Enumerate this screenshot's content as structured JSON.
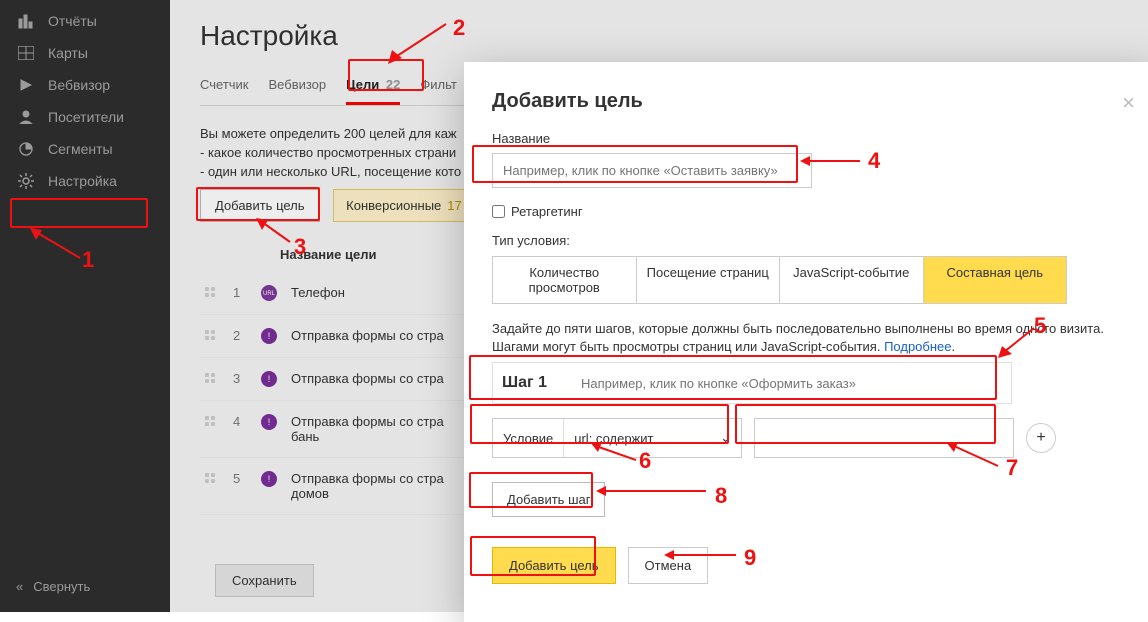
{
  "sidebar": {
    "items": [
      {
        "label": "Отчёты"
      },
      {
        "label": "Карты"
      },
      {
        "label": "Вебвизор"
      },
      {
        "label": "Посетители"
      },
      {
        "label": "Сегменты"
      },
      {
        "label": "Настройка"
      }
    ],
    "collapse": "Свернуть"
  },
  "page": {
    "title": "Настройка"
  },
  "tabs": [
    {
      "label": "Счетчик"
    },
    {
      "label": "Вебвизор"
    },
    {
      "label": "Цели",
      "count": "22"
    },
    {
      "label": "Фильт"
    }
  ],
  "hint": {
    "intro": "Вы можете определить 200 целей для каж",
    "l1": "- какое количество просмотренных страни",
    "l2": "- один или несколько URL, посещение кото"
  },
  "buttons": {
    "addGoal": "Добавить цель",
    "conversions": "Конверсионные",
    "convCount": "17"
  },
  "tableHead": "Название цели",
  "goals": [
    {
      "n": "1",
      "name": "Телефон",
      "ic": "URL"
    },
    {
      "n": "2",
      "name": "Отправка формы со стра",
      "ic": "!"
    },
    {
      "n": "3",
      "name": "Отправка формы со стра",
      "ic": "!"
    },
    {
      "n": "4",
      "name": "Отправка формы со страБань",
      "ic": "!"
    },
    {
      "n": "5",
      "name": "Отправка формы со страДомов",
      "ic": "!"
    }
  ],
  "save": "Сохранить",
  "modal": {
    "title": "Добавить цель",
    "close": "×",
    "nameLabel": "Название",
    "namePlaceholder": "Например, клик по кнопке «Оставить заявку»",
    "retarget": "Ретаргетинг",
    "condType": "Тип условия:",
    "condTabs": [
      "Количество просмотров",
      "Посещение страниц",
      "JavaScript-событие",
      "Составная цель"
    ],
    "stepDesc1": "Задайте до пяти шагов, которые должны быть последовательно выполнены во время одного визита.",
    "stepDesc2": "Шагами могут быть просмотры страниц или JavaScript-события. ",
    "more": "Подробнее",
    "stepLabel": "Шаг 1",
    "stepPlaceholder": "Например, клик по кнопке «Оформить заказ»",
    "condLabel": "Условие",
    "condValue": "url: содержит",
    "addStep": "Добавить шаг",
    "submit": "Добавить цель",
    "cancel": "Отмена"
  },
  "ann": {
    "1": "1",
    "2": "2",
    "3": "3",
    "4": "4",
    "5": "5",
    "6": "6",
    "7": "7",
    "8": "8",
    "9": "9"
  }
}
